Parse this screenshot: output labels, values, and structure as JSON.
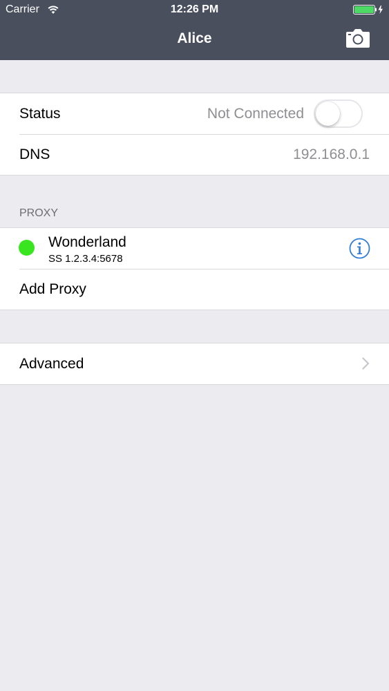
{
  "status_bar": {
    "carrier": "Carrier",
    "time": "12:26 PM",
    "battery_color": "#4CD964"
  },
  "nav": {
    "title": "Alice",
    "right_icon": "camera-icon"
  },
  "connection": {
    "status_label": "Status",
    "status_value": "Not Connected",
    "toggle_on": false,
    "dns_label": "DNS",
    "dns_value": "192.168.0.1"
  },
  "proxy_section": {
    "header": "PROXY",
    "items": [
      {
        "name": "Wonderland",
        "detail": "SS 1.2.3.4:5678",
        "status_color": "#39E51F",
        "accessory_icon": "info-icon"
      }
    ],
    "add_label": "Add Proxy"
  },
  "advanced": {
    "label": "Advanced",
    "accessory_icon": "chevron-right-icon"
  },
  "colors": {
    "nav_background": "#4A4F5E",
    "page_background": "#ECEBF0",
    "accent": "#2F7CD6"
  }
}
